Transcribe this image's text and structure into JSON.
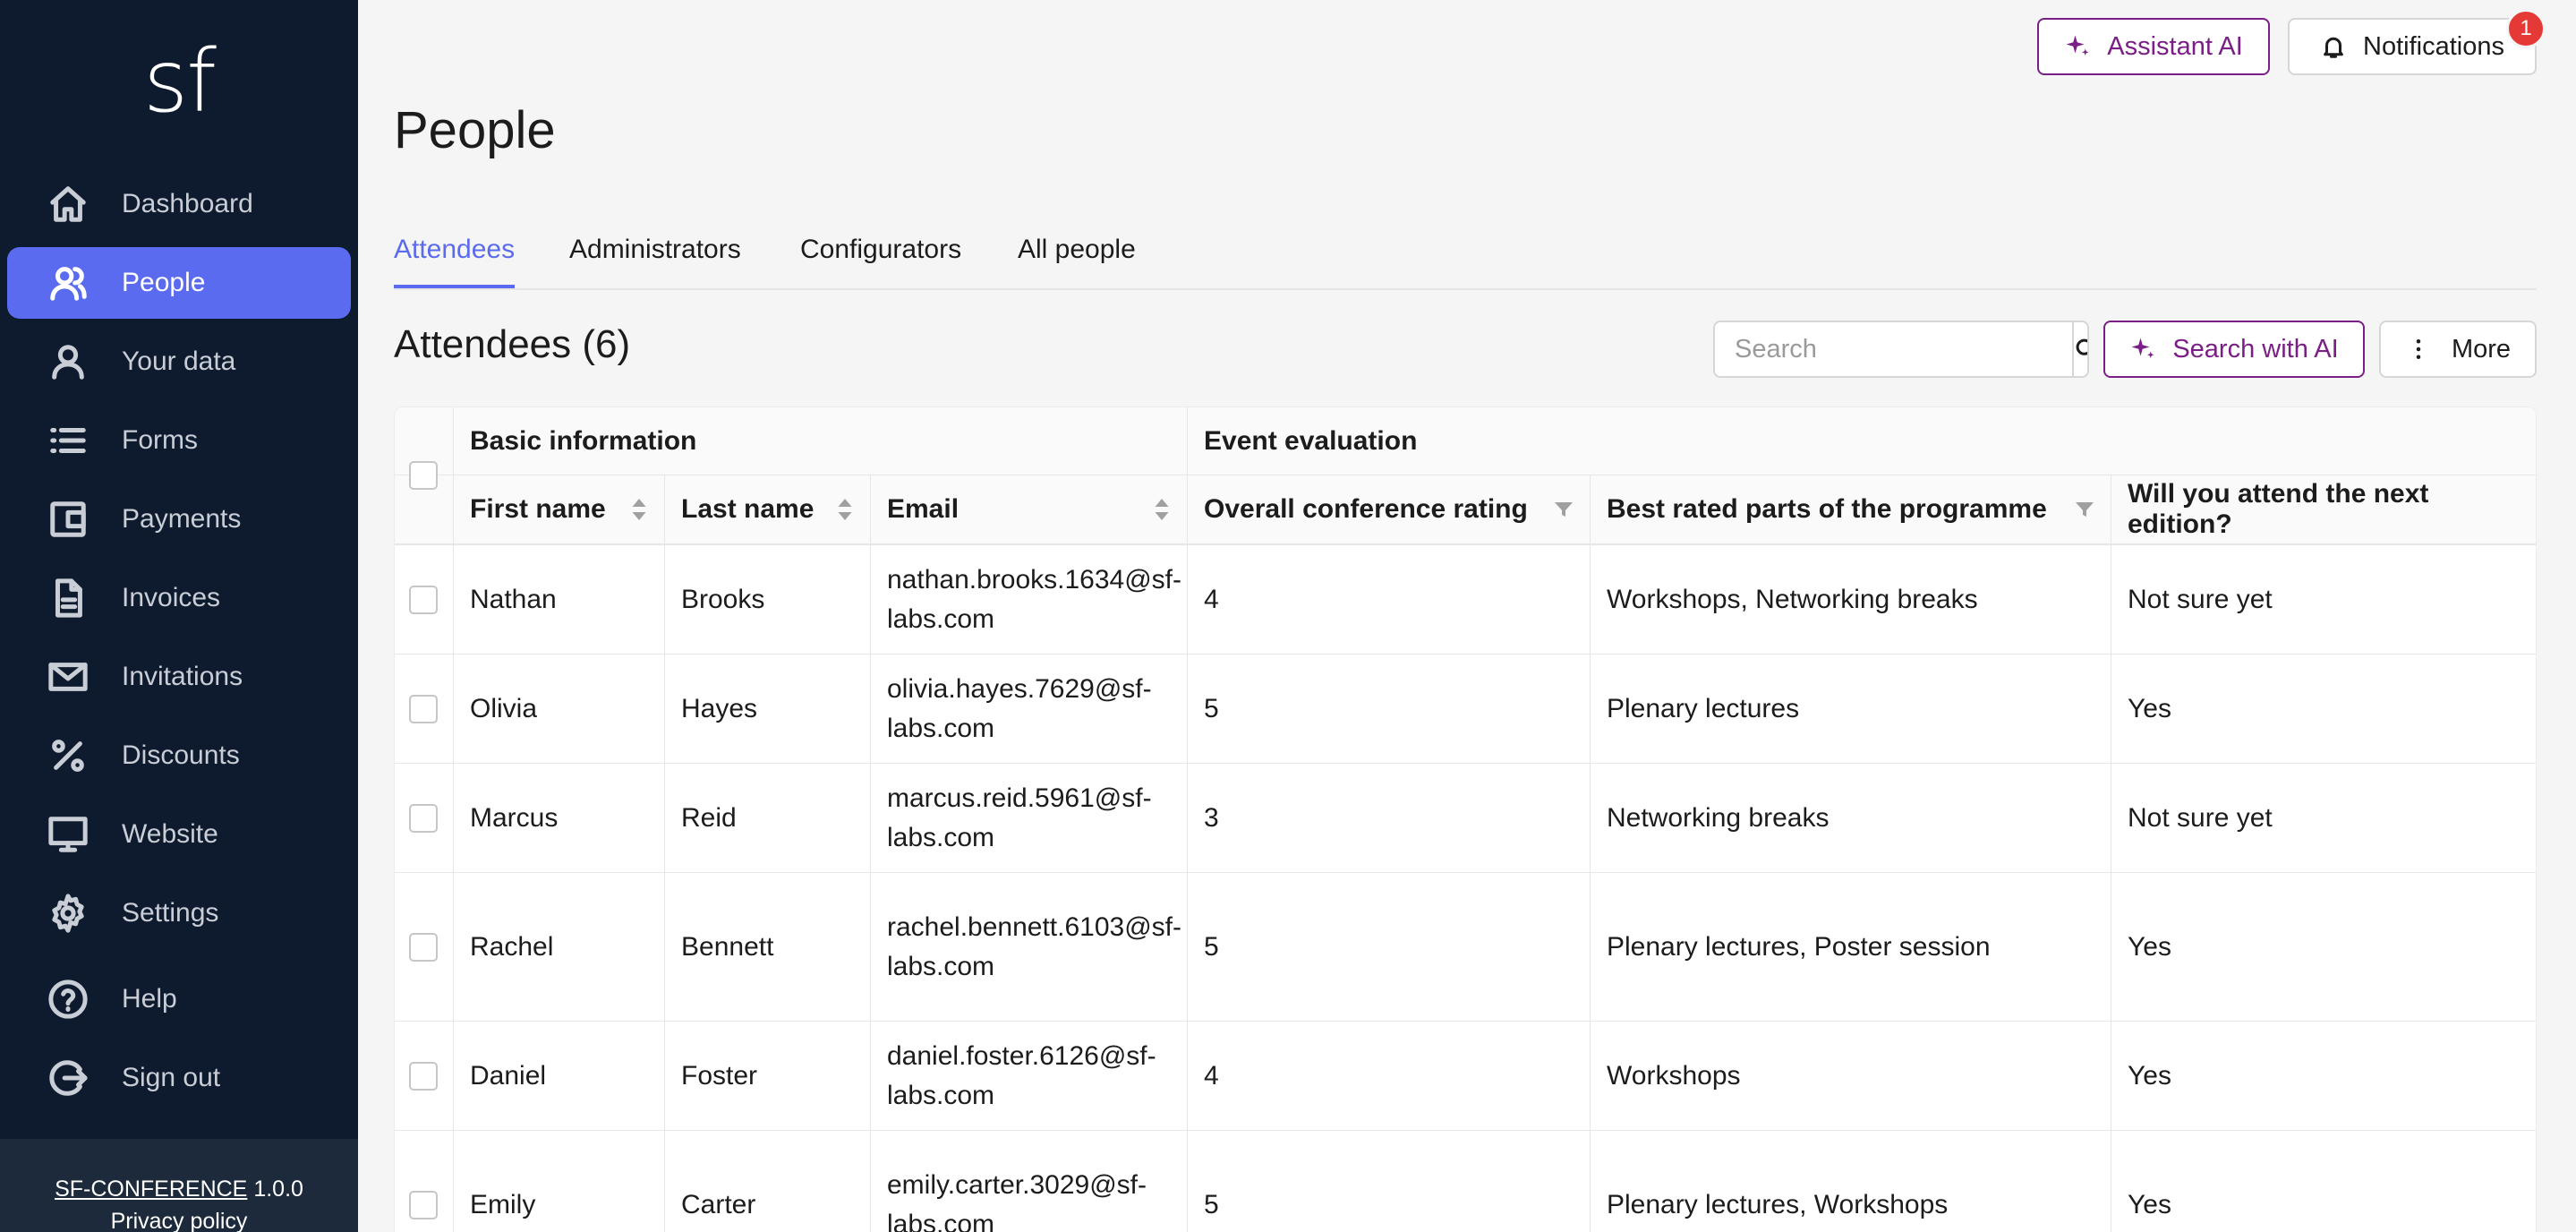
{
  "sidebar": {
    "logo": "sf",
    "items": [
      {
        "label": "Dashboard",
        "icon": "home-icon"
      },
      {
        "label": "People",
        "icon": "people-icon",
        "active": true
      },
      {
        "label": "Your data",
        "icon": "user-icon"
      },
      {
        "label": "Forms",
        "icon": "list-icon"
      },
      {
        "label": "Payments",
        "icon": "wallet-icon"
      },
      {
        "label": "Invoices",
        "icon": "document-icon"
      },
      {
        "label": "Invitations",
        "icon": "mail-icon"
      },
      {
        "label": "Discounts",
        "icon": "percent-icon"
      },
      {
        "label": "Website",
        "icon": "monitor-icon"
      },
      {
        "label": "Settings",
        "icon": "gear-icon"
      },
      {
        "label": "Help",
        "icon": "help-icon"
      },
      {
        "label": "Sign out",
        "icon": "sign-out-icon"
      }
    ],
    "footer": {
      "app_name": "SF-CONFERENCE",
      "version": "1.0.0",
      "privacy": "Privacy policy"
    }
  },
  "topbar": {
    "assistant_label": "Assistant AI",
    "notifications_label": "Notifications",
    "notifications_count": "1"
  },
  "page": {
    "title": "People",
    "tabs": [
      {
        "label": "Attendees",
        "active": true
      },
      {
        "label": "Administrators"
      },
      {
        "label": "Configurators"
      },
      {
        "label": "All people"
      }
    ],
    "section_title": "Attendees (6)",
    "search_placeholder": "Search",
    "search_ai_label": "Search with AI",
    "more_label": "More"
  },
  "colors": {
    "sidebar_bg": "#0e1b2e",
    "accent": "#5b6bef",
    "ai_accent": "#7a1f86",
    "badge": "#e53935"
  },
  "table": {
    "groups": [
      "Basic information",
      "Event evaluation"
    ],
    "columns": [
      "First name",
      "Last name",
      "Email",
      "Overall conference rating",
      "Best rated parts of the programme",
      "Will you attend the next edition?"
    ],
    "rows": [
      {
        "first": "Nathan",
        "last": "Brooks",
        "email1": "nathan.brooks.1634@sf-",
        "email2": "labs.com",
        "rating": "4",
        "parts": "Workshops, Networking breaks",
        "next": "Not sure yet"
      },
      {
        "first": "Olivia",
        "last": "Hayes",
        "email1": "olivia.hayes.7629@sf-",
        "email2": "labs.com",
        "rating": "5",
        "parts": "Plenary lectures",
        "next": "Yes"
      },
      {
        "first": "Marcus",
        "last": "Reid",
        "email1": "marcus.reid.5961@sf-",
        "email2": "labs.com",
        "rating": "3",
        "parts": "Networking breaks",
        "next": "Not sure yet"
      },
      {
        "first": "Rachel",
        "last": "Bennett",
        "email1": "rachel.bennett.6103@sf-",
        "email2": "labs.com",
        "rating": "5",
        "parts": "Plenary lectures, Poster session",
        "next": "Yes"
      },
      {
        "first": "Daniel",
        "last": "Foster",
        "email1": "daniel.foster.6126@sf-",
        "email2": "labs.com",
        "rating": "4",
        "parts": "Workshops",
        "next": "Yes"
      },
      {
        "first": "Emily",
        "last": "Carter",
        "email1": "emily.carter.3029@sf-",
        "email2": "labs.com",
        "rating": "5",
        "parts": "Plenary lectures, Workshops",
        "next": "Yes"
      }
    ]
  }
}
